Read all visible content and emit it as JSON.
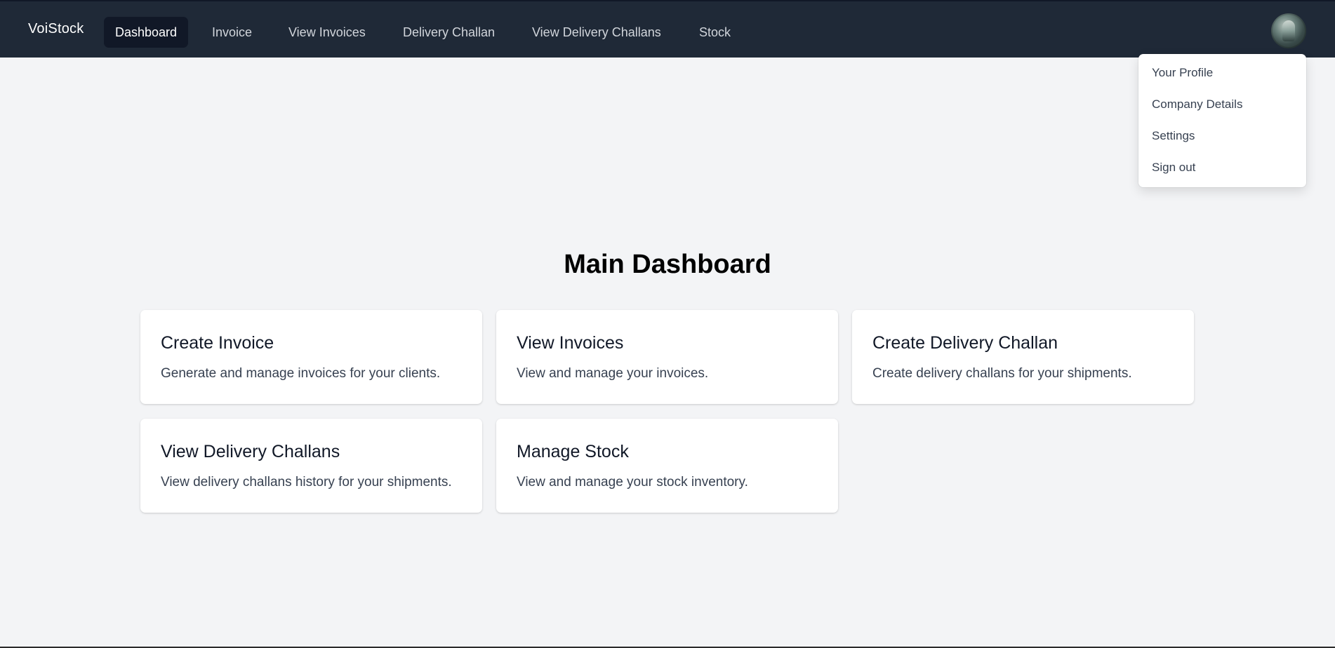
{
  "navbar": {
    "brand": "VoiStock",
    "items": [
      {
        "label": "Dashboard",
        "active": true
      },
      {
        "label": "Invoice",
        "active": false
      },
      {
        "label": "View Invoices",
        "active": false
      },
      {
        "label": "Delivery Challan",
        "active": false
      },
      {
        "label": "View Delivery Challans",
        "active": false
      },
      {
        "label": "Stock",
        "active": false
      }
    ],
    "avatar_icon": "user-avatar"
  },
  "profile_menu": {
    "items": [
      {
        "label": "Your Profile"
      },
      {
        "label": "Company Details"
      },
      {
        "label": "Settings"
      },
      {
        "label": "Sign out"
      }
    ]
  },
  "main": {
    "title": "Main Dashboard",
    "cards": [
      {
        "title": "Create Invoice",
        "description": "Generate and manage invoices for your clients."
      },
      {
        "title": "View Invoices",
        "description": "View and manage your invoices."
      },
      {
        "title": "Create Delivery Challan",
        "description": "Create delivery challans for your shipments."
      },
      {
        "title": "View Delivery Challans",
        "description": "View delivery challans history for your shipments."
      },
      {
        "title": "Manage Stock",
        "description": "View and manage your stock inventory."
      }
    ]
  },
  "colors": {
    "navbar_bg": "#1f2937",
    "active_item_bg": "#111827",
    "page_bg": "#f3f4f6"
  }
}
